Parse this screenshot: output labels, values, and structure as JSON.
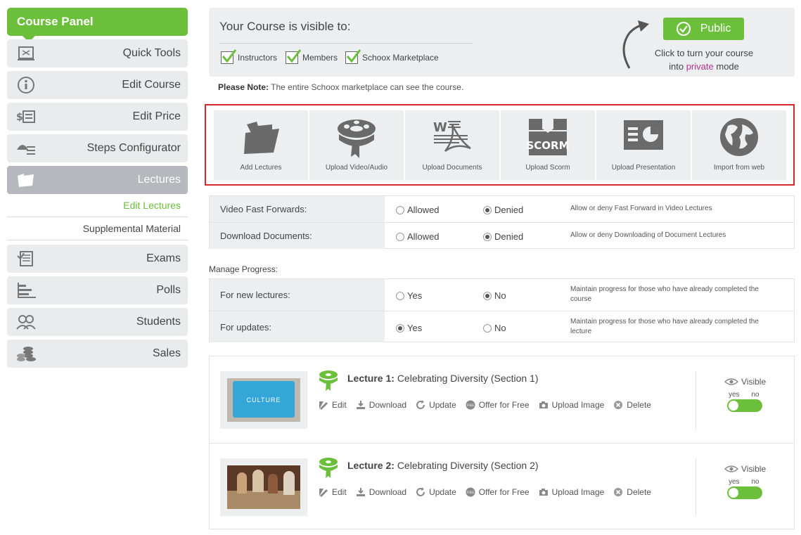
{
  "sidebar": {
    "title": "Course Panel",
    "items": [
      {
        "label": "Quick Tools",
        "icon": "book-icon"
      },
      {
        "label": "Edit Course",
        "icon": "info-icon"
      },
      {
        "label": "Edit Price",
        "icon": "price-icon"
      },
      {
        "label": "Steps Configurator",
        "icon": "steps-icon"
      },
      {
        "label": "Lectures",
        "icon": "folder-icon",
        "active": true
      }
    ],
    "sub_items": [
      "Edit Lectures",
      "Supplemental Material"
    ],
    "items_after": [
      {
        "label": "Exams",
        "icon": "exam-icon"
      },
      {
        "label": "Polls",
        "icon": "poll-icon"
      },
      {
        "label": "Students",
        "icon": "students-icon"
      },
      {
        "label": "Sales",
        "icon": "coins-icon"
      }
    ]
  },
  "visibility": {
    "title": "Your Course is visible to:",
    "checks": [
      "Instructors",
      "Members",
      "Schoox Marketplace"
    ],
    "public_label": "Public",
    "turn_text_1": "Click to turn your course",
    "turn_text_2a": "into",
    "turn_text_private": "private",
    "turn_text_2b": "mode"
  },
  "note": {
    "bold": "Please Note:",
    "text": "The entire Schoox marketplace can see the course."
  },
  "tools": [
    {
      "label": "Add Lectures",
      "icon": "folder-icon"
    },
    {
      "label": "Upload Video/Audio",
      "icon": "film-reel-icon"
    },
    {
      "label": "Upload Documents",
      "icon": "documents-icon"
    },
    {
      "label": "Upload Scorm",
      "icon": "scorm-box-icon"
    },
    {
      "label": "Upload Presentation",
      "icon": "presentation-icon"
    },
    {
      "label": "Import from web",
      "icon": "globe-icon"
    }
  ],
  "settings": {
    "fast_forward": {
      "label": "Video Fast Forwards:",
      "opt1": "Allowed",
      "opt2": "Denied",
      "desc": "Allow or deny Fast Forward in Video Lectures"
    },
    "download_docs": {
      "label": "Download Documents:",
      "opt1": "Allowed",
      "opt2": "Denied",
      "desc": "Allow or deny Downloading of Document Lectures"
    }
  },
  "manage_progress": {
    "label": "Manage Progress:",
    "new_lectures": {
      "label": "For new lectures:",
      "opt1": "Yes",
      "opt2": "No",
      "desc": "Maintain progress for those who have already completed the course"
    },
    "updates": {
      "label": "For updates:",
      "opt1": "Yes",
      "opt2": "No",
      "desc": "Maintain progress for those who have already completed the lecture"
    }
  },
  "lectures": [
    {
      "number": "Lecture 1:",
      "title": "Celebrating Diversity (Section 1)",
      "thumb_text": "CULTURE"
    },
    {
      "number": "Lecture 2:",
      "title": "Celebrating Diversity (Section 2)"
    }
  ],
  "lecture_actions": [
    "Edit",
    "Download",
    "Update",
    "Offer for Free",
    "Upload Image",
    "Delete"
  ],
  "lecture_visible": {
    "label": "Visible",
    "yes": "yes",
    "no": "no"
  },
  "colors": {
    "green": "#6bbf3b",
    "red_border": "#d9262c",
    "private": "#b0338f"
  }
}
